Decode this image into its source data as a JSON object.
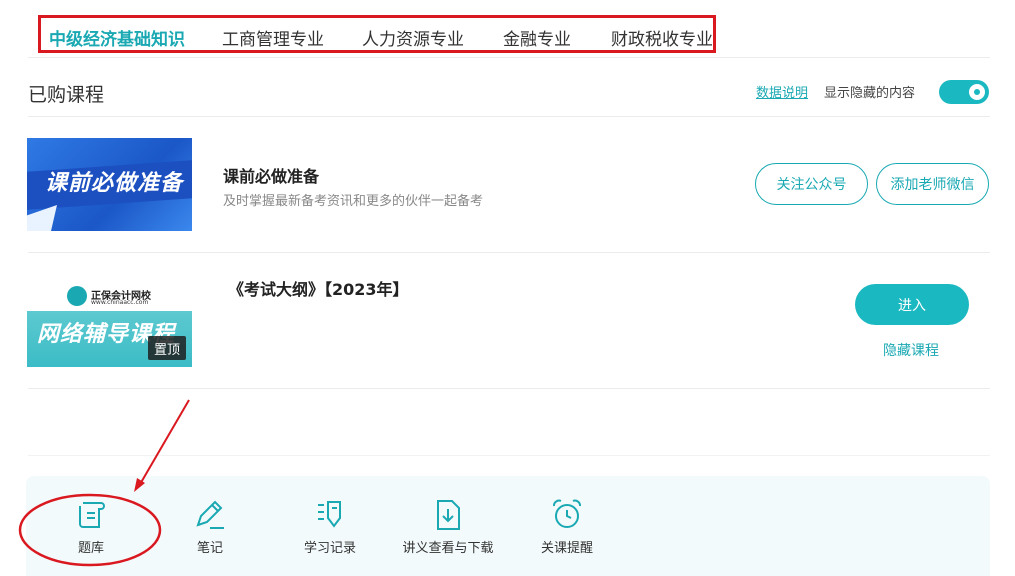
{
  "tabs": [
    {
      "label": "中级经济基础知识",
      "active": true
    },
    {
      "label": "工商管理专业",
      "active": false
    },
    {
      "label": "人力资源专业",
      "active": false
    },
    {
      "label": "金融专业",
      "active": false
    },
    {
      "label": "财政税收专业",
      "active": false
    }
  ],
  "section": {
    "title": "已购课程",
    "data_link": "数据说明",
    "show_hidden_label": "显示隐藏的内容",
    "show_hidden_on": true
  },
  "courses": [
    {
      "thumb_text": "课前必做准备",
      "title": "课前必做准备",
      "subtitle": "及时掌握最新备考资讯和更多的伙伴一起备考",
      "buttons": [
        "关注公众号",
        "添加老师微信"
      ]
    },
    {
      "thumb_logo": "正保会计网校",
      "thumb_url": "www.chinaacc.com",
      "thumb_text": "网络辅导课程",
      "pin_label": "置顶",
      "title": "《考试大纲》【2023年】",
      "enter_label": "进入",
      "hide_label": "隐藏课程"
    }
  ],
  "tools": [
    {
      "label": "题库",
      "icon": "question-bank-icon"
    },
    {
      "label": "笔记",
      "icon": "notes-icon"
    },
    {
      "label": "学习记录",
      "icon": "study-record-icon"
    },
    {
      "label": "讲义查看与下载",
      "icon": "handout-download-icon"
    },
    {
      "label": "关课提醒",
      "icon": "alarm-clock-icon"
    }
  ],
  "colors": {
    "accent": "#1aa9b3",
    "annotation": "#d9181f"
  }
}
